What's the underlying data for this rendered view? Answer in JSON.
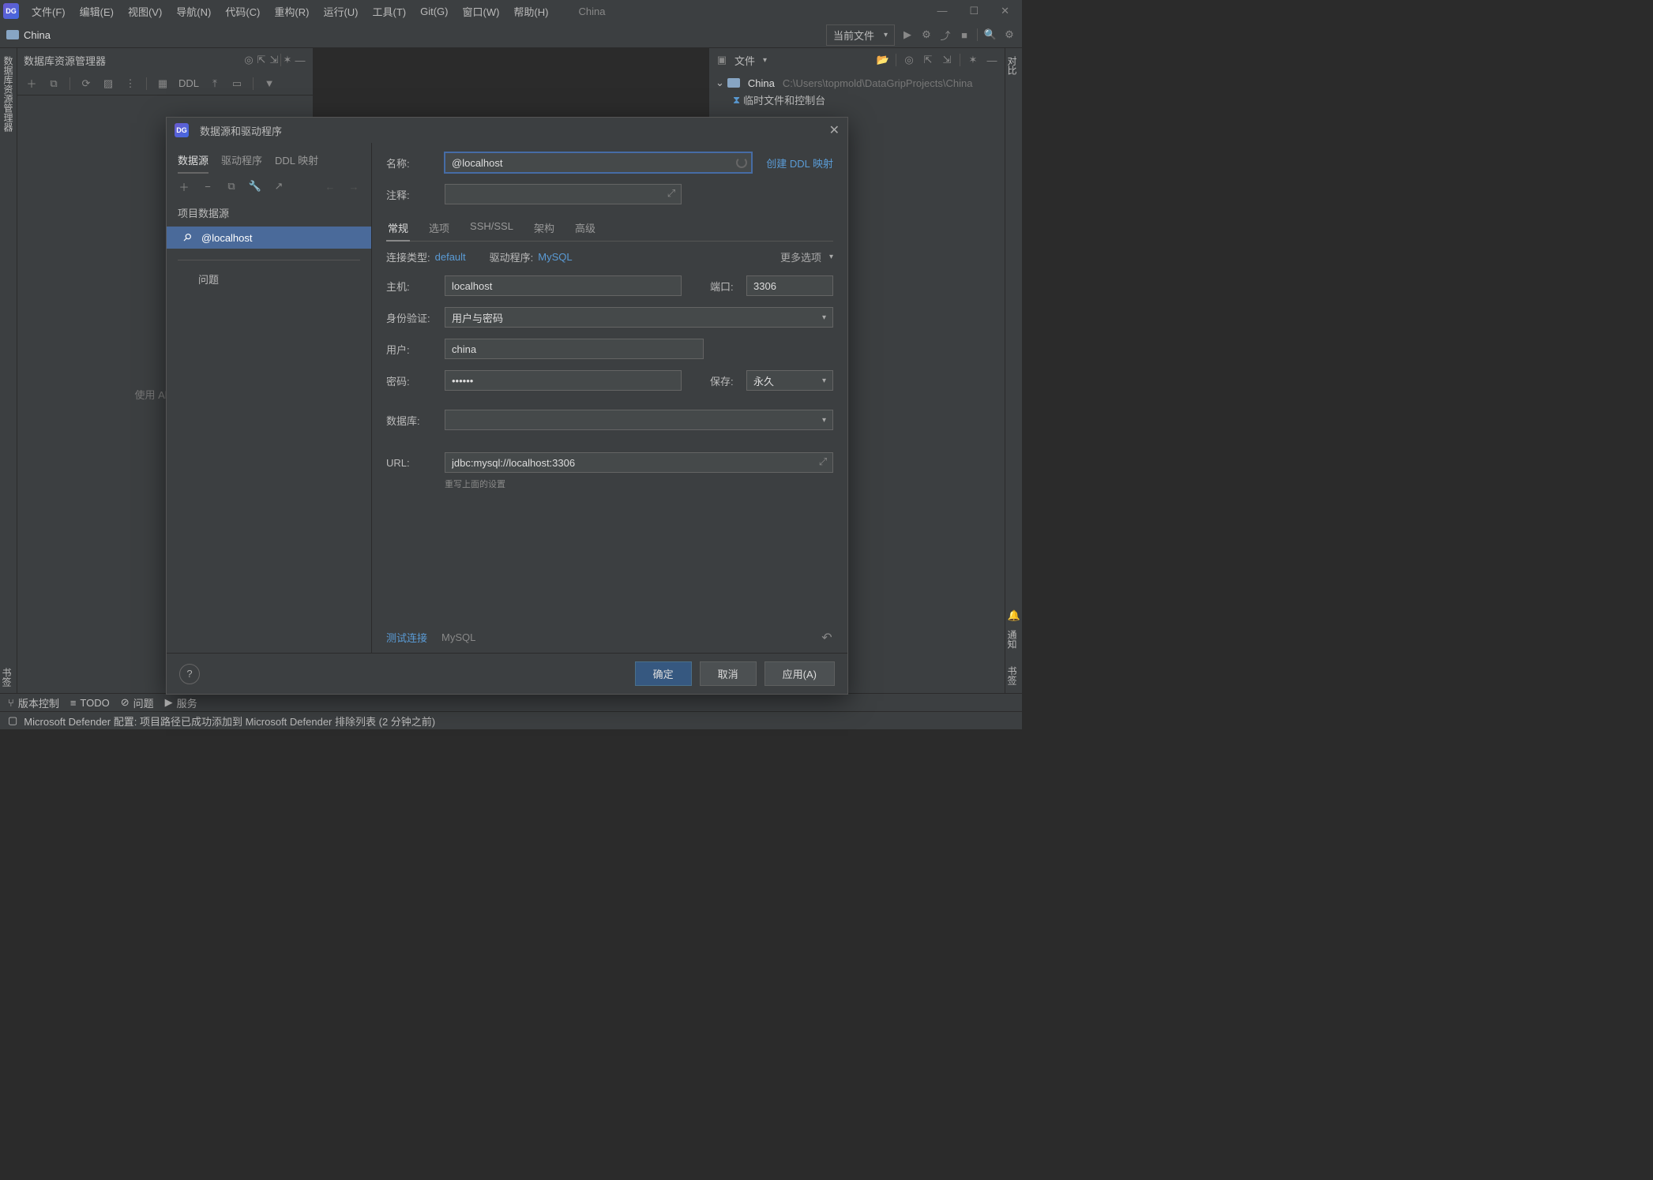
{
  "app": {
    "icon_text": "DG",
    "window_title": "China"
  },
  "menu": {
    "file": "文件(F)",
    "edit": "编辑(E)",
    "view": "视图(V)",
    "navigate": "导航(N)",
    "code": "代码(C)",
    "refactor": "重构(R)",
    "run": "运行(U)",
    "tools": "工具(T)",
    "git": "Git(G)",
    "window": "窗口(W)",
    "help": "帮助(H)"
  },
  "breadcrumb": {
    "project": "China",
    "run_config": "当前文件"
  },
  "db_panel": {
    "title": "数据库资源管理器",
    "ddl_btn": "DDL",
    "hint": "使用 Alt+Inse"
  },
  "left_gutter": {
    "db_label": "数据库资源管理器"
  },
  "files_panel": {
    "dropdown": "文件",
    "root_name": "China",
    "root_path": "C:\\Users\\topmold\\DataGripProjects\\China",
    "scratch": "临时文件和控制台"
  },
  "dialog": {
    "title": "数据源和驱动程序",
    "side_tabs": {
      "sources": "数据源",
      "drivers": "驱动程序",
      "ddl": "DDL 映射"
    },
    "section_project": "项目数据源",
    "ds_localhost": "@localhost",
    "section_problems": "问题",
    "form": {
      "name_label": "名称:",
      "name_value": "@localhost",
      "create_ddl_link": "创建 DDL 映射",
      "comment_label": "注释:",
      "comment_value": "",
      "tabs": {
        "general": "常规",
        "options": "选项",
        "ssh": "SSH/SSL",
        "schema": "架构",
        "advanced": "高级"
      },
      "conn_type_label": "连接类型:",
      "conn_type_value": "default",
      "driver_label": "驱动程序:",
      "driver_value": "MySQL",
      "more_options": "更多选项",
      "host_label": "主机:",
      "host_value": "localhost",
      "port_label": "端口:",
      "port_value": "3306",
      "auth_label": "身份验证:",
      "auth_value": "用户与密码",
      "user_label": "用户:",
      "user_value": "china",
      "password_label": "密码:",
      "password_value": "••••••",
      "save_label": "保存:",
      "save_value": "永久",
      "database_label": "数据库:",
      "database_value": "",
      "url_label": "URL:",
      "url_value": "jdbc:mysql://localhost:3306",
      "url_hint": "重写上面的设置",
      "test_connection": "测试连接",
      "driver_info": "MySQL"
    },
    "buttons": {
      "ok": "确定",
      "cancel": "取消",
      "apply": "应用(A)",
      "help": "?"
    }
  },
  "bottom": {
    "vcs": "版本控制",
    "todo": "TODO",
    "problems": "问题",
    "services": "服务"
  },
  "status": {
    "message": "Microsoft Defender 配置: 项目路径已成功添加到 Microsoft Defender 排除列表 (2 分钟之前)"
  },
  "right_gutter": {
    "compare": "对比",
    "bookmarks": "书签",
    "notifications": "通知"
  }
}
